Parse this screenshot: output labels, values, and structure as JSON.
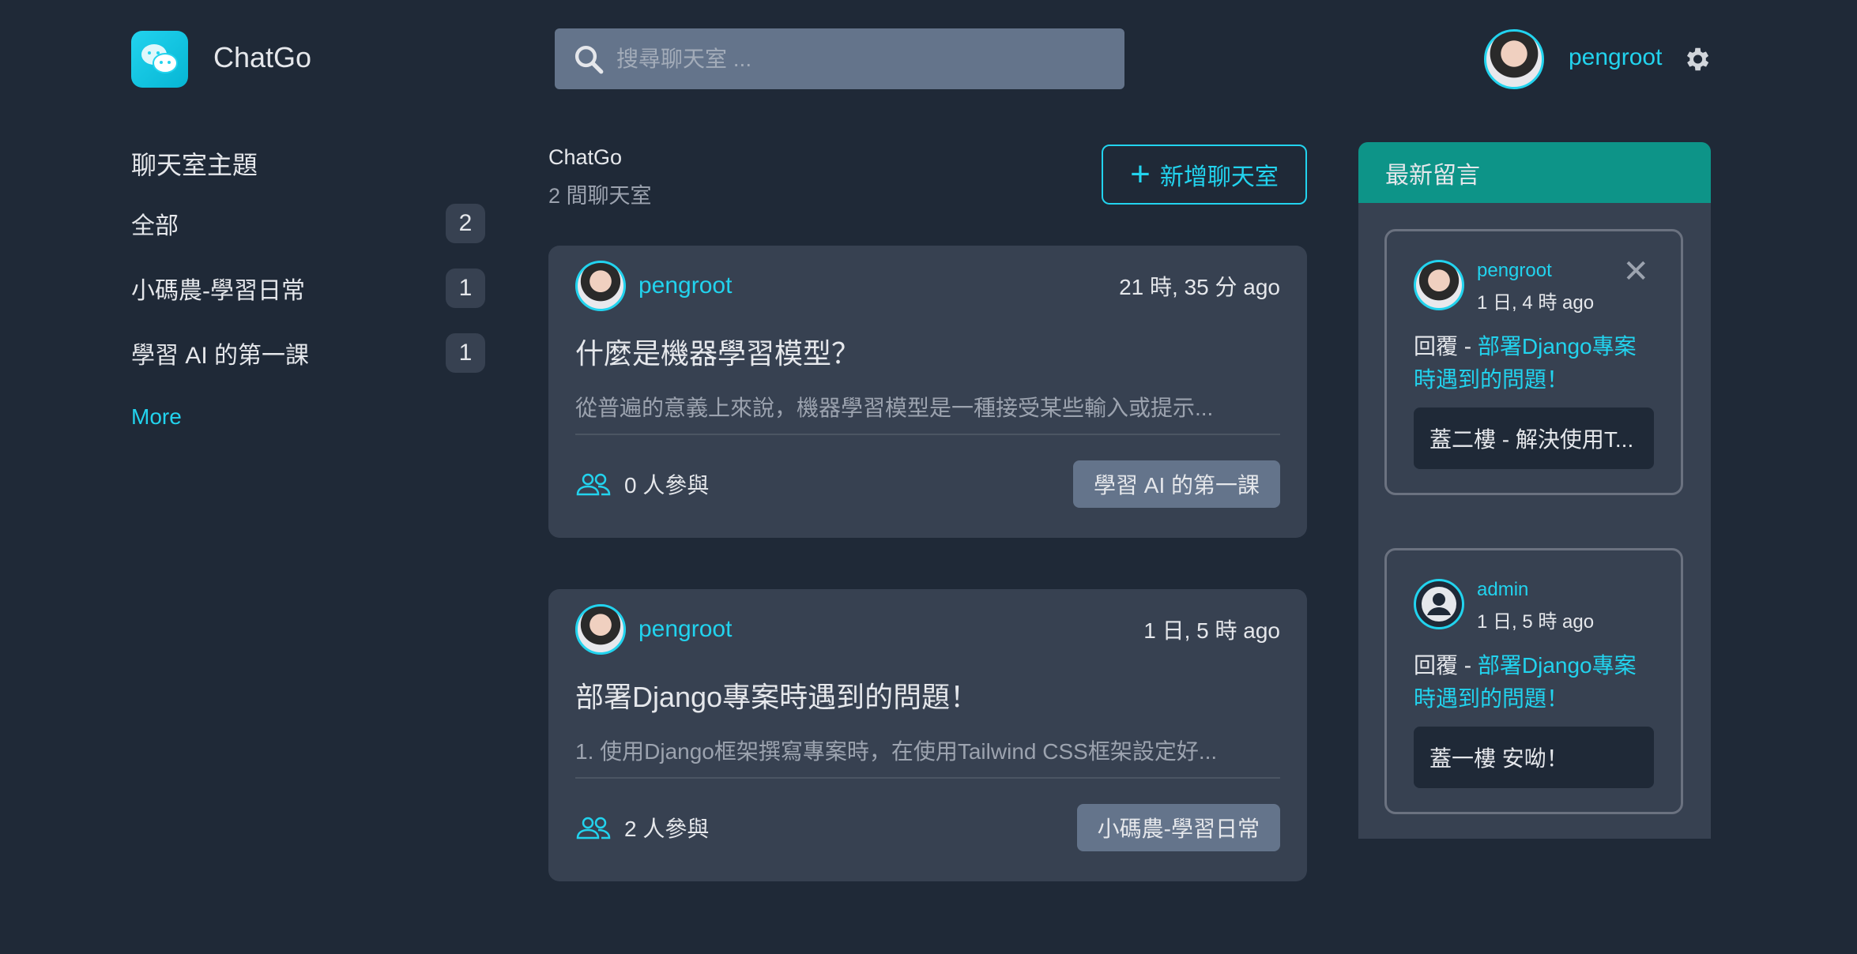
{
  "header": {
    "brand": "ChatGo",
    "search_placeholder": "搜尋聊天室 ...",
    "username": "pengroot"
  },
  "sidebar": {
    "title": "聊天室主題",
    "items": [
      {
        "label": "全部",
        "count": "2"
      },
      {
        "label": "小碼農-學習日常",
        "count": "1"
      },
      {
        "label": "學習 AI 的第一課",
        "count": "1"
      }
    ],
    "more": "More"
  },
  "main": {
    "title": "ChatGo",
    "subtitle": "2 間聊天室",
    "new_button": "新增聊天室",
    "rooms": [
      {
        "host": "pengroot",
        "time": "21 時, 35 分 ago",
        "title": "什麼是機器學習模型？",
        "desc": "從普遍的意義上來說，機器學習模型是一種接受某些輸入或提示...",
        "participants": "0 人參與",
        "topic": "學習 AI 的第一課"
      },
      {
        "host": "pengroot",
        "time": "1 日, 5 時 ago",
        "title": "部署Django專案時遇到的問題！",
        "desc": "1. 使用Django框架撰寫專案時，在使用Tailwind CSS框架設定好...",
        "participants": "2 人參與",
        "topic": "小碼農-學習日常"
      }
    ]
  },
  "activity": {
    "title": "最新留言",
    "items": [
      {
        "user": "pengroot",
        "time": "1 日, 4 時 ago",
        "reply_prefix": "回覆 - ",
        "room": "部署Django專案時遇到的問題！",
        "message": "蓋二樓 - 解決使用T..."
      },
      {
        "user": "admin",
        "time": "1 日, 5 時 ago",
        "reply_prefix": "回覆 - ",
        "room": "部署Django專案時遇到的問題！",
        "message": "蓋一樓 安呦！"
      }
    ]
  },
  "colors": {
    "accent": "#22d3ee",
    "background": "#1f2937",
    "card": "#374151",
    "panel_header": "#0d9488"
  }
}
